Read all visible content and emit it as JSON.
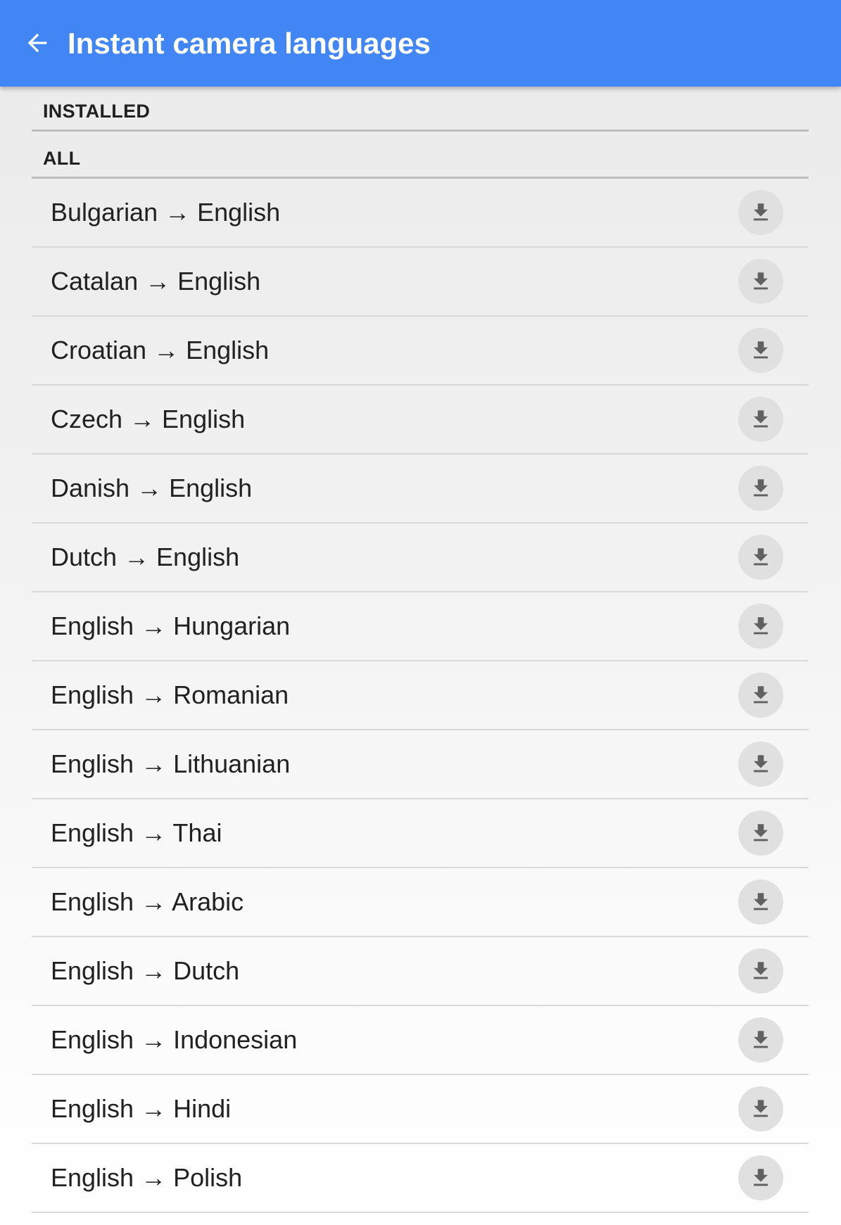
{
  "app_bar": {
    "title": "Instant camera languages",
    "back_icon": "arrow-back-icon",
    "color": "#4285f4"
  },
  "sections": {
    "installed_label": "INSTALLED",
    "all_label": "ALL"
  },
  "languages": [
    {
      "label": "Bulgarian → English",
      "icon": "download-icon"
    },
    {
      "label": "Catalan → English",
      "icon": "download-icon"
    },
    {
      "label": "Croatian → English",
      "icon": "download-icon"
    },
    {
      "label": "Czech → English",
      "icon": "download-icon"
    },
    {
      "label": "Danish → English",
      "icon": "download-icon"
    },
    {
      "label": "Dutch → English",
      "icon": "download-icon"
    },
    {
      "label": "English → Hungarian",
      "icon": "download-icon"
    },
    {
      "label": "English → Romanian",
      "icon": "download-icon"
    },
    {
      "label": "English → Lithuanian",
      "icon": "download-icon"
    },
    {
      "label": "English → Thai",
      "icon": "download-icon"
    },
    {
      "label": "English → Arabic",
      "icon": "download-icon"
    },
    {
      "label": "English → Dutch",
      "icon": "download-icon"
    },
    {
      "label": "English → Indonesian",
      "icon": "download-icon"
    },
    {
      "label": "English → Hindi",
      "icon": "download-icon"
    },
    {
      "label": "English → Polish",
      "icon": "download-icon"
    }
  ]
}
